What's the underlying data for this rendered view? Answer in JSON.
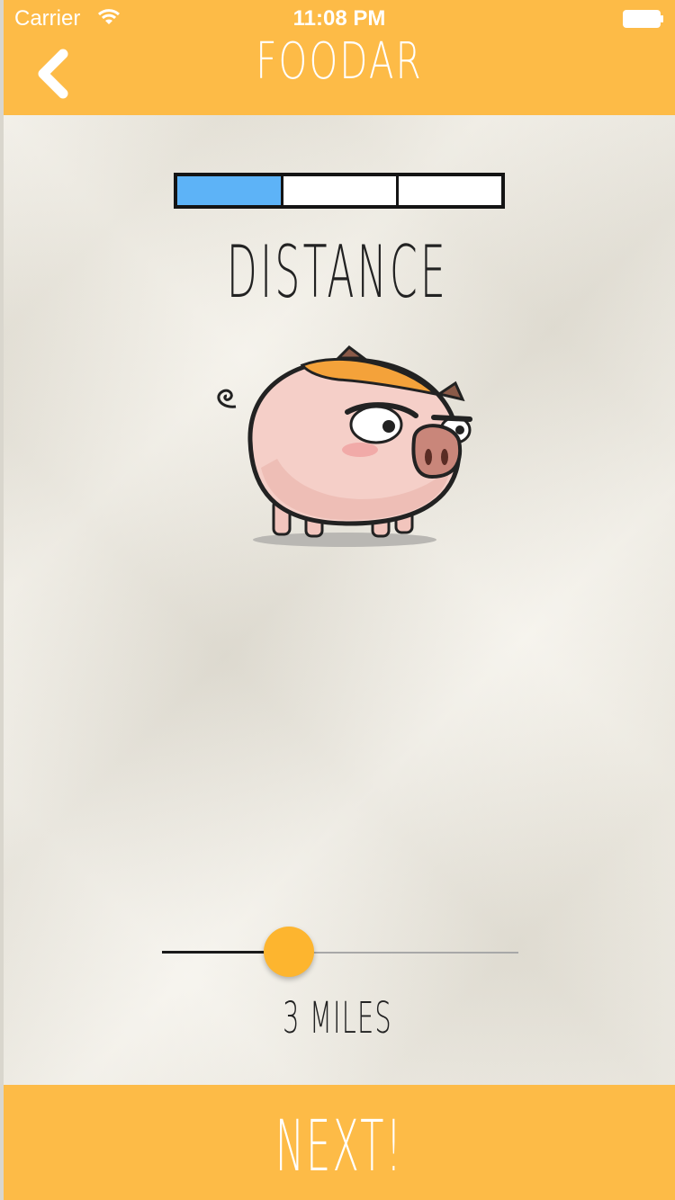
{
  "status_bar": {
    "carrier": "Carrier",
    "time": "11:08 PM"
  },
  "header": {
    "title": "FOODAR",
    "back_icon": "chevron-left-icon"
  },
  "progress": {
    "total_steps": 3,
    "current_step": 1
  },
  "main": {
    "heading": "DISTANCE",
    "mascot": "pig-illustration"
  },
  "slider": {
    "value": 3,
    "min": 0,
    "max": 10,
    "fraction": 0.34,
    "value_label": "3 MILES"
  },
  "footer": {
    "next_label": "NEXT!"
  },
  "colors": {
    "accent": "#fdbb47",
    "progress_fill": "#5db3f7",
    "slider_thumb": "#fdb52f"
  }
}
